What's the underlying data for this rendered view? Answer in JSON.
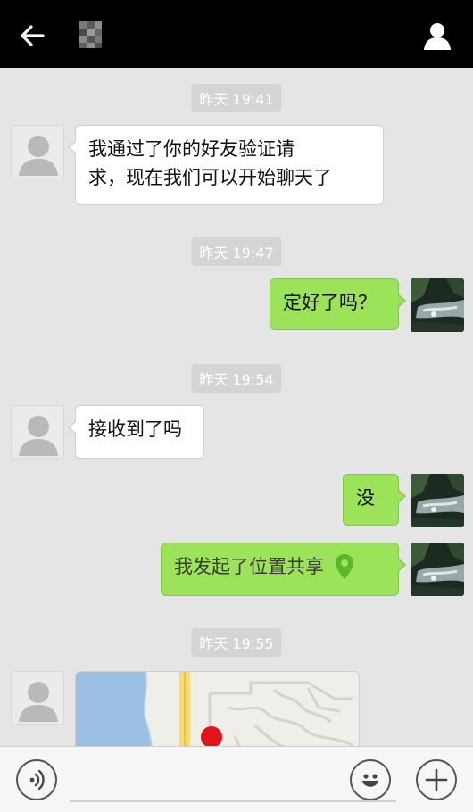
{
  "header": {
    "back_icon": "arrow-left-icon",
    "profile_icon": "person-icon"
  },
  "messages": [
    {
      "time": "昨天 19:41"
    },
    {
      "direction": "in",
      "text": "我通过了你的好友验证请求，现在我们可以开始聊天了"
    },
    {
      "time": "昨天 19:47"
    },
    {
      "direction": "out",
      "text": "定好了吗？"
    },
    {
      "time": "昨天 19:54"
    },
    {
      "direction": "in",
      "text": "接收到了吗"
    },
    {
      "direction": "out",
      "text": "没"
    },
    {
      "direction": "out",
      "text": "我发起了位置共享",
      "icon": "location-pin-icon"
    },
    {
      "time": "昨天 19:55"
    },
    {
      "direction": "in",
      "type": "map",
      "icon": "map-marker-icon"
    }
  ],
  "bubble_lines": {
    "m1_line1": "我通过了你的好友验证请",
    "m1_line2": "求，现在我们可以开始聊天了"
  },
  "input_bar": {
    "voice_icon": "voice-icon",
    "emoji_icon": "smiley-icon",
    "plus_icon": "plus-icon",
    "value": ""
  },
  "colors": {
    "topbar": "#000000",
    "chat_background": "#e5e5e5",
    "outgoing_bubble": "#9de35a",
    "incoming_bubble": "#ffffff",
    "timestamp_chip": "#d4d4d4",
    "location_pin": "#58b82a",
    "map_marker": "#e0141a"
  }
}
